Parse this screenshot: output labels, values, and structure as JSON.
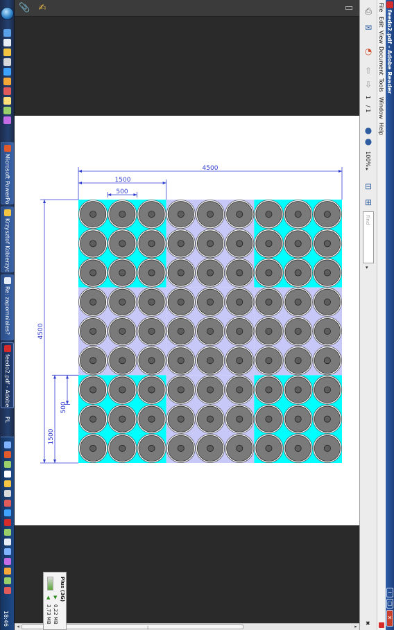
{
  "window": {
    "title": "feedo2.pdf - Adobe Reader",
    "controls": [
      "−",
      "▢",
      "✕"
    ]
  },
  "menu": [
    "File",
    "Edit",
    "View",
    "Document",
    "Tools",
    "Window",
    "Help"
  ],
  "toolbar": {
    "page_current": "1",
    "page_total": "/ 1",
    "zoom": "100%",
    "find_placeholder": "Find"
  },
  "taskbar": {
    "buttons": [
      {
        "label": "Microsoft PowerPo...",
        "icon": "powerpoint-icon"
      },
      {
        "label": "Krzysztof Kobierzyc...",
        "icon": "folder-icon"
      },
      {
        "label": "Re: zapomniales?",
        "icon": "mail-icon"
      },
      {
        "label": "feedo2.pdf - Adobe...",
        "icon": "adobe-reader-icon"
      }
    ],
    "language": "PL",
    "clock": "18:46"
  },
  "notification": {
    "title": "Plus (3G)",
    "upload": "0,22 MB",
    "download": "3,73 MB"
  },
  "colors": {
    "cyan": "#00ffff",
    "lavender": "#c8c8f8",
    "disk_fill": "#7a7a7a",
    "dimension": "#2f3bd0",
    "taskbar": "#24406f",
    "titlebar": "#2f5faa"
  },
  "drawing": {
    "dim_total_top": "4500",
    "dim_block_top": "1500",
    "dim_cell_top": "500",
    "dim_total_left": "4500",
    "dim_block_left": "1500",
    "dim_cell_left": "500",
    "grid": {
      "rows": 9,
      "cols": 9,
      "block_pattern": [
        [
          "cyan",
          "lavender",
          "cyan"
        ],
        [
          "lavender",
          "lavender",
          "lavender"
        ],
        [
          "cyan",
          "lavender",
          "cyan"
        ]
      ]
    }
  }
}
